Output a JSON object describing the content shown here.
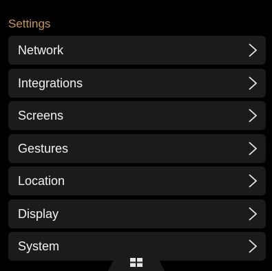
{
  "header": {
    "title": "Settings",
    "title_color": "#c8965f"
  },
  "menu": {
    "items": [
      {
        "label": "Network",
        "icon": "chevron-right-icon"
      },
      {
        "label": "Integrations",
        "icon": "chevron-right-icon"
      },
      {
        "label": "Screens",
        "icon": "chevron-right-icon"
      },
      {
        "label": "Gestures",
        "icon": "chevron-right-icon"
      },
      {
        "label": "Location",
        "icon": "chevron-right-icon"
      },
      {
        "label": "Display",
        "icon": "chevron-right-icon"
      },
      {
        "label": "System",
        "icon": "chevron-right-icon"
      }
    ]
  },
  "bottom_bar": {
    "icon": "grid-icon"
  },
  "colors": {
    "background": "#000000",
    "item_background": "#1b1b1b",
    "text": "#f2f2f2",
    "accent": "#c8965f"
  }
}
